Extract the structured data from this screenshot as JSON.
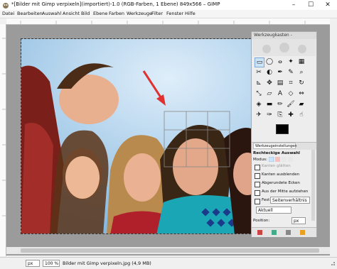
{
  "window": {
    "title": "*[Bilder mit Gimp verpixeln](importiert)-1.0 (RGB-Farben, 1 Ebene) 849x566 – GIMP",
    "minimize_icon": "minimize-icon",
    "maximize_icon": "maximize-icon",
    "close_icon": "close-icon"
  },
  "menu": {
    "items": [
      "Datei",
      "Bearbeiten",
      "Auswahl",
      "Ansicht",
      "Bild",
      "Ebene",
      "Farben",
      "Werkzeuge",
      "Filter",
      "Fenster",
      "Hilfe"
    ]
  },
  "toolbox": {
    "title": "Werkzeugkasten - Werkzeug...",
    "tab_label": "Werkzeugeinstellungen",
    "tool_name": "Rechteckige Auswahl",
    "modus_label": "Modus:",
    "antialias_label": "Kanten glätten",
    "options": [
      "Kanten ausblenden",
      "Abgerundete Ecken",
      "Aus der Mitte aufziehen"
    ],
    "fest_label": "Fest:",
    "fest_value": "Seitenverhältnis",
    "aktuell_value": "Aktuell",
    "position_label": "Position:",
    "position_unit": "px"
  },
  "status": {
    "unit": "px",
    "zoom": "100 %",
    "file_info": "Bilder mit Gimp verpixeln.jpg (4,9 MB)"
  },
  "colors": {
    "accent": "#e03030",
    "fg_color": "#000000",
    "bg_color": "#ffffff"
  }
}
